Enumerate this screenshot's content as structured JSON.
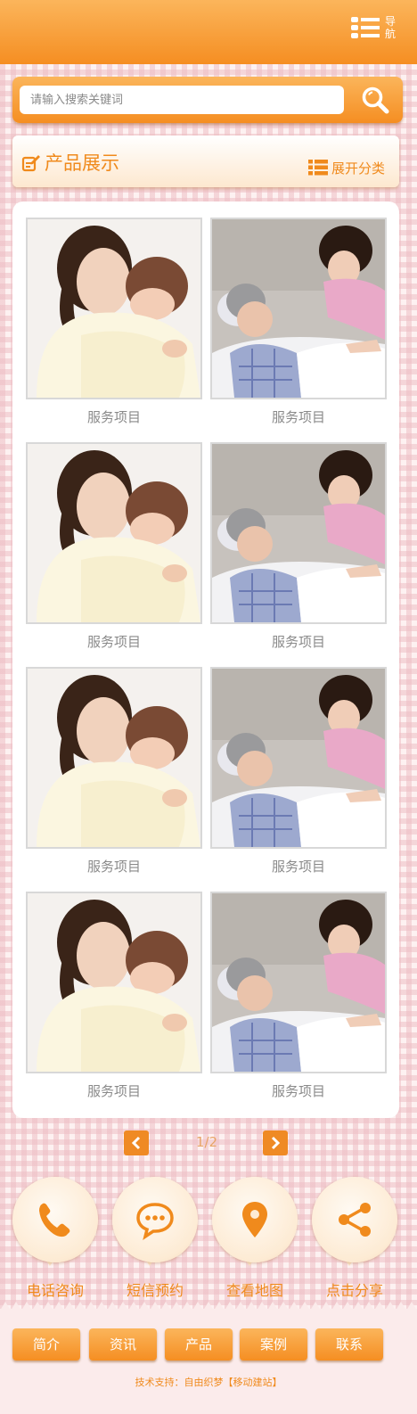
{
  "header": {
    "nav_label": "导航",
    "nav_icon": "menu-list-icon"
  },
  "search": {
    "placeholder": "请输入搜索关键词",
    "icon": "search-icon"
  },
  "section": {
    "title": "产品展示",
    "title_icon": "edit-note-icon",
    "expand_label": "展开分类",
    "expand_icon": "list-icon"
  },
  "products": [
    {
      "label": "服务项目",
      "image": "mother-baby-photo"
    },
    {
      "label": "服务项目",
      "image": "nurse-elderly-photo"
    },
    {
      "label": "服务项目",
      "image": "mother-baby-photo"
    },
    {
      "label": "服务项目",
      "image": "nurse-elderly-photo"
    },
    {
      "label": "服务项目",
      "image": "mother-baby-photo"
    },
    {
      "label": "服务项目",
      "image": "nurse-elderly-photo"
    },
    {
      "label": "服务项目",
      "image": "mother-baby-photo"
    },
    {
      "label": "服务项目",
      "image": "nurse-elderly-photo"
    }
  ],
  "pagination": {
    "text": "1/2",
    "prev_icon": "chevron-left-icon",
    "next_icon": "chevron-right-icon"
  },
  "actions": [
    {
      "label": "电话咨询",
      "icon": "phone-icon"
    },
    {
      "label": "短信预约",
      "icon": "chat-bubble-icon"
    },
    {
      "label": "查看地图",
      "icon": "map-pin-icon"
    },
    {
      "label": "点击分享",
      "icon": "share-icon"
    }
  ],
  "footer": {
    "nav": [
      "简介",
      "资讯",
      "产品",
      "案例",
      "联系"
    ],
    "copyright": "技术支持：自由织梦【移动建站】"
  },
  "colors": {
    "accent": "#f58e22",
    "accent_light": "#fbb55b",
    "label_gray": "#8a8a8a",
    "background": "#fdf1f1"
  }
}
